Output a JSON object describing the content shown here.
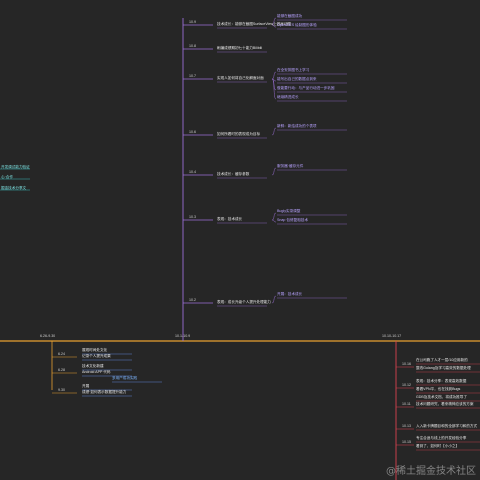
{
  "colors": {
    "background": "#262626",
    "timeline": "#e8a030",
    "branch_purple": "#9b6fd6",
    "branch_blue": "#6b9bff",
    "branch_red": "#d9414f",
    "branch_cyan": "#39b3b6"
  },
  "timeline": {
    "segments": [
      {
        "label": "6.26-9.30"
      },
      {
        "label": "10.1-10.9"
      },
      {
        "label": "10.10-10.17"
      }
    ]
  },
  "left_edge": [
    {
      "text": "开发调试能力验证"
    },
    {
      "text": "心·合作"
    },
    {
      "text": "掘金技术分享文"
    }
  ],
  "middle_branch": [
    {
      "date": "10.9",
      "items": [
        "技术成长：能够在截图SurfaceView上做画动图",
        "能够在截图成功",
        "OpenGlES 绘制图形体验"
      ]
    },
    {
      "date": "10.8",
      "items": [
        "刷编成绩期初七十能力Bilibili"
      ]
    },
    {
      "date": "10.7",
      "items": [
        "实现人如何将自己化解面对面",
        "在全安排图书上学习",
        "能写出自己的数据点到来",
        "做能要行动：与产品行动进一步巩固",
        "继续精进成长"
      ]
    },
    {
      "date": "10.6",
      "items": [
        "如何所看时的表现成为目标",
        "新鲜：新结成功的个表项"
      ]
    },
    {
      "date": "10.4",
      "items": [
        "技术成长：缓存参数",
        "服务器·缓存元件"
      ]
    },
    {
      "date": "10.3",
      "items": [
        "表现：技术成长",
        "Bugly实录调整",
        "Snap 包修复相技术"
      ]
    },
    {
      "date": "10.2",
      "items": [
        "表现：成长升级个人提升处理能力",
        "开展：技术成长"
      ]
    }
  ],
  "bottom_left": [
    {
      "date": "6.24",
      "items": [
        "展现时间处文化",
        "记录个人提升成果"
      ]
    },
    {
      "date": "6.28",
      "items": [
        "技术文化新建",
        "Android APP 代码",
        "多用户成功实践"
      ]
    },
    {
      "date": "9.30",
      "items": [
        "开展",
        "成绩·如何表示数据提升能力"
      ]
    }
  ],
  "right_branch": [
    {
      "date": "10.16",
      "items": [
        "在公司跑了人才一层/10应用新的",
        "整改Golang及学习高效的数据处理"
      ]
    },
    {
      "date": "10.12",
      "items": [
        "表现：技术分享：表现高效数据",
        "看看VPN平，也在找到Bugs",
        "GDB及技术文档，将成功推导了"
      ]
    },
    {
      "date": "10.11",
      "items": [
        "技术问题研究，看来精神应该的方案"
      ]
    },
    {
      "date": "10.13",
      "items": [
        "入入新卡牌题目和的全部学习和的方式"
      ]
    },
    {
      "date": "10.15",
      "items": [
        "专注合适与线上的开发经验分享",
        "看到了，如何时【小小之】"
      ]
    }
  ],
  "watermark": "@稀土掘金技术社区"
}
